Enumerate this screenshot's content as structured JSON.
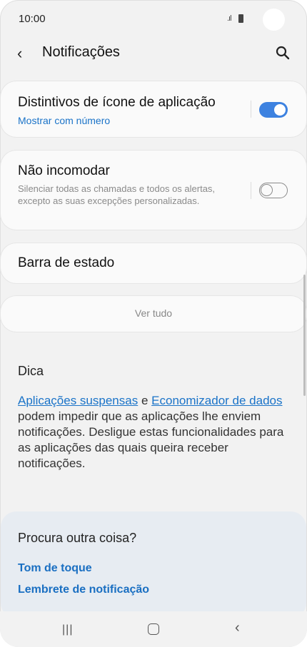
{
  "status": {
    "time": "10:00"
  },
  "appbar": {
    "title": "Notificações"
  },
  "cards": {
    "badges": {
      "title": "Distintivos de ícone de aplicação",
      "subtitle": "Mostrar com número",
      "toggle": "on"
    },
    "dnd": {
      "title": "Não incomodar",
      "description": "Silenciar todas as chamadas e todos os alertas, excepto as suas excepções personalizadas.",
      "toggle": "off"
    },
    "statusbar": {
      "title": "Barra de estado"
    },
    "see_all": {
      "label": "Ver tudo"
    }
  },
  "tip": {
    "title": "Dica",
    "link1": "Aplicações suspensas",
    "connector": "e",
    "link2": "Economizador de dados",
    "text": "podem impedir que as aplicações lhe enviem notificações. Desligue estas funcionalidades para as aplicações das quais queira receber notificações."
  },
  "looking": {
    "question": "Procura outra coisa?",
    "links": [
      "Tom de toque",
      "Lembrete de notificação"
    ]
  },
  "colors": {
    "accent": "#3d82e0",
    "link": "#1a73c8"
  }
}
